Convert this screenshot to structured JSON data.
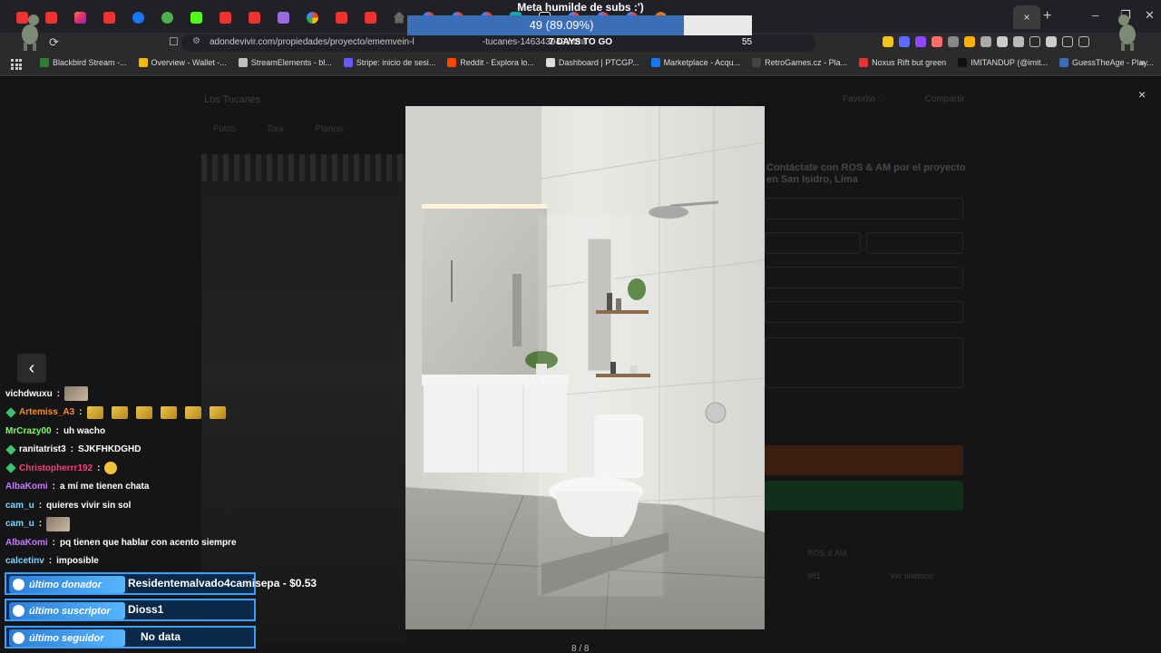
{
  "browser": {
    "tab_icons": [
      "youtube",
      "youtube",
      "instagram",
      "youtube",
      "meta",
      "green",
      "kick",
      "youtube",
      "youtube",
      "pen",
      "google",
      "youtube",
      "youtube",
      "home",
      "google",
      "google",
      "google",
      "teal",
      "tiktok",
      "google",
      "google",
      "google",
      "question"
    ],
    "active_tab_close": "×",
    "new_tab": "+",
    "window_controls": [
      "–",
      "❐",
      "✕"
    ],
    "url": "adondevivir.com/propiedades/proyecto/ememvein-l",
    "url_tail": "-tucanes-146343949.html",
    "reload": "⟳",
    "bookmarks": [
      {
        "label": "Blackbird Stream -...",
        "color": "#2e7d32"
      },
      {
        "label": "Overview - Wallet -...",
        "color": "#f0b90b"
      },
      {
        "label": "StreamElements - bl...",
        "color": "#c0c0c0"
      },
      {
        "label": "Stripe: inicio de sesi...",
        "color": "#635bff"
      },
      {
        "label": "Reddit - Explora lo...",
        "color": "#ff4500"
      },
      {
        "label": "Dashboard | PTCGP...",
        "color": "#dddddd"
      },
      {
        "label": "Marketplace - Acqu...",
        "color": "#1877f2"
      },
      {
        "label": "RetroGames.cz - Pla...",
        "color": "#444444"
      },
      {
        "label": "Noxus Rift but green",
        "color": "#e33333"
      },
      {
        "label": "IMITANDUP (@imit...",
        "color": "#111111"
      },
      {
        "label": "GuessTheAge - Play...",
        "color": "#3a6fb8"
      }
    ],
    "bookmarks_more": "»"
  },
  "page": {
    "title": "Los Tucanes",
    "favorite": "Favorito ♡",
    "share": "Compartir",
    "tabs": [
      "Fotos",
      "Tour",
      "Planos"
    ],
    "form_title": "Contáctate con ROS & AM por el proyecto en San Isidro, Lima",
    "advertiser": "ROS & AM",
    "phone_partial": "981",
    "phone_label": "Ver teléfono",
    "counter": "8 / 8",
    "close": "×",
    "prev": "‹"
  },
  "goal": {
    "title": "Meta humilde de subs :')",
    "value_label": "49 (89.09%)",
    "percent": 89.09,
    "days_left": "7 DAYS TO GO",
    "target": "55",
    "fill_color": "#3a6fb8"
  },
  "chat": [
    {
      "name": "vichdwuxu",
      "color": "#ffffff",
      "badge": false,
      "msg": "",
      "emote": "pic"
    },
    {
      "name": "Artemiss_A3",
      "color": "#ff8c1a",
      "badge": true,
      "msg": "",
      "emote": "gold6"
    },
    {
      "name": "MrCrazy00",
      "color": "#7cff5a",
      "badge": false,
      "msg": "uh wacho",
      "emote": ""
    },
    {
      "name": "ranitatrist3",
      "color": "#ffffff",
      "badge": true,
      "msg": "SJKFHKDGHD",
      "emote": ""
    },
    {
      "name": "Christopherrr192",
      "color": "#ff3b7f",
      "badge": true,
      "msg": "",
      "emote": "face"
    },
    {
      "name": "AlbaKomi",
      "color": "#c37bff",
      "badge": false,
      "msg": "a mí me tienen chata",
      "emote": ""
    },
    {
      "name": "cam_u",
      "color": "#7fd6ff",
      "badge": false,
      "msg": "quieres vivir sin sol",
      "emote": ""
    },
    {
      "name": "cam_u",
      "color": "#7fd6ff",
      "badge": false,
      "msg": "",
      "emote": "pic"
    },
    {
      "name": "AlbaKomi",
      "color": "#c37bff",
      "badge": false,
      "msg": "pq tienen que hablar con acento siempre",
      "emote": ""
    },
    {
      "name": "calcetinv",
      "color": "#7fd6ff",
      "badge": false,
      "msg": "imposible",
      "emote": ""
    }
  ],
  "alerts": {
    "donor_label": "último donador",
    "donor_value": "Residentemalvado4camisepa - $0.53",
    "sub_label": "último suscriptor",
    "sub_value": "Dioss1",
    "follower_label": "último seguidor",
    "follower_value": "No data"
  }
}
